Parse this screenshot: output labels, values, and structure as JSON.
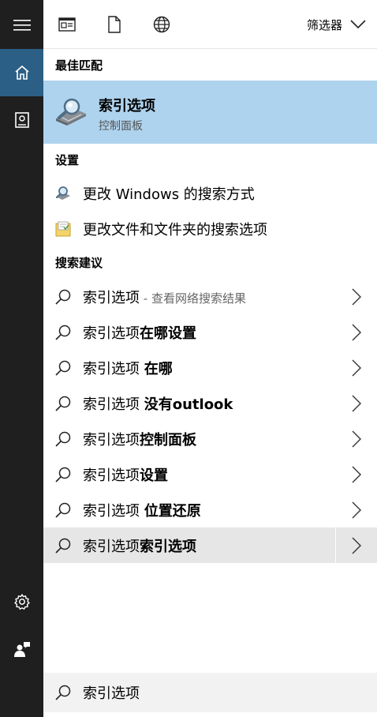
{
  "rail": {
    "items": [
      {
        "icon": "hamburger-icon"
      },
      {
        "icon": "home-icon"
      },
      {
        "icon": "notebook-icon"
      },
      {
        "icon": "gear-icon"
      },
      {
        "icon": "feedback-icon"
      }
    ]
  },
  "topbar": {
    "filter_label": "筛选器",
    "icons": [
      "app-icon",
      "document-icon",
      "globe-icon"
    ]
  },
  "best_match": {
    "heading": "最佳匹配",
    "title": "索引选项",
    "subtitle": "控制面板"
  },
  "settings": {
    "heading": "设置",
    "items": [
      {
        "label": "更改 Windows 的搜索方式"
      },
      {
        "label": "更改文件和文件夹的搜索选项"
      }
    ]
  },
  "suggestions": {
    "heading": "搜索建议",
    "items": [
      {
        "prefix": "索引选项",
        "bold": "",
        "hint": " - 查看网络搜索结果"
      },
      {
        "prefix": "索引选项",
        "bold": "在哪设置",
        "hint": ""
      },
      {
        "prefix": "索引选项 ",
        "bold": "在哪",
        "hint": ""
      },
      {
        "prefix": "索引选项 ",
        "bold": "没有outlook",
        "hint": ""
      },
      {
        "prefix": "索引选项",
        "bold": "控制面板",
        "hint": ""
      },
      {
        "prefix": "索引选项",
        "bold": "设置",
        "hint": ""
      },
      {
        "prefix": "索引选项 ",
        "bold": "位置还原",
        "hint": ""
      },
      {
        "prefix": "索引选项",
        "bold": "索引选项",
        "hint": ""
      }
    ]
  },
  "search": {
    "value": "索引选项"
  },
  "colors": {
    "rail_bg": "#1f1f1f",
    "rail_active": "#2b5f86",
    "best_match_bg": "#aed3ee",
    "highlight_bg": "#e6e6e6",
    "searchbox_bg": "#f2f2f2"
  }
}
